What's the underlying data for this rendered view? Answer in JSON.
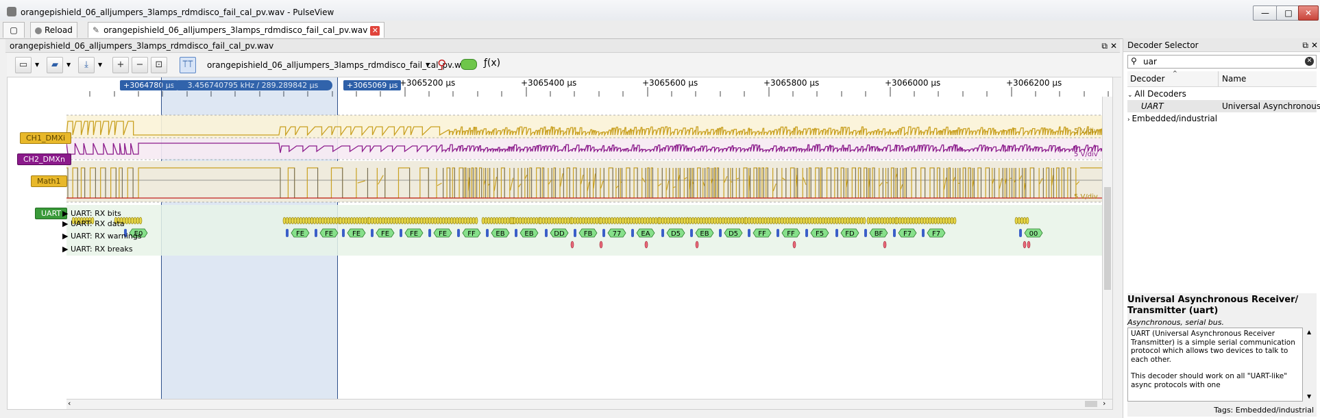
{
  "window": {
    "title": "orangepishield_06_alljumpers_3lamps_rdmdisco_fail_cal_pv.wav - PulseView",
    "min_label": "—",
    "max_label": "□",
    "close_label": "✕"
  },
  "tabs": {
    "reload_label": "Reload",
    "session_tab_label": "orangepishield_06_alljumpers_3lamps_rdmdisco_fail_cal_pv.wav"
  },
  "session_dock": {
    "title": "orangepishield_06_alljumpers_3lamps_rdmdisco_fail_cal_pv.wav"
  },
  "toolbar": {
    "device_label": "orangepishield_06_alljumpers_3lamps_rdmdisco_fail_cal_pv.wav"
  },
  "ruler": {
    "cursor_left": "+3064780 µs",
    "cursor_mid": "3.456740795 kHz / 289.289842 µs",
    "cursor_right": "+3065069 µs",
    "ticks": [
      "+3065200 µs",
      "+3065400 µs",
      "+3065600 µs",
      "+3065800 µs",
      "+3066000 µs",
      "+3066200 µs"
    ]
  },
  "signals": {
    "ch1": {
      "name": "CH1_DMXi",
      "color": "#c9a020",
      "scale": "5 V/div"
    },
    "ch2": {
      "name": "CH2_DMXn",
      "color": "#8b1a8b",
      "scale": "5 V/div"
    },
    "math": {
      "name": "Math1",
      "color": "#c9a020",
      "scale": "5 V/div"
    },
    "uart": {
      "name": "UART",
      "color": "#3a9a3a"
    }
  },
  "decoder_rows": {
    "rx_bits": "UART: RX bits",
    "rx_data": "UART: RX data",
    "rx_warnings": "UART: RX warnings",
    "rx_breaks": "UART: RX breaks"
  },
  "rx_data_values": [
    "E0",
    "FE",
    "FE",
    "FE",
    "FE",
    "FE",
    "FE",
    "FF",
    "EB",
    "EB",
    "DD",
    "FB",
    "77",
    "EA",
    "D5",
    "EB",
    "D5",
    "FF",
    "FF",
    "F5",
    "FD",
    "BF",
    "F7",
    "F7",
    "00"
  ],
  "decoder_selector": {
    "title": "Decoder Selector",
    "search_value": "uar",
    "col_decoder": "Decoder",
    "col_name": "Name",
    "all_decoders": "All Decoders",
    "uart_id": "UART",
    "uart_name": "Universal Asynchronous ...",
    "embedded": "Embedded/industrial",
    "info_title": "Universal Asynchronous Receiver/ Transmitter (uart)",
    "info_subtitle": "Asynchronous, serial bus.",
    "info_desc_1": "UART (Universal Asynchronous Receiver Transmitter) is a simple serial communication protocol which allows two devices to talk to each other.",
    "info_desc_2": "This decoder should work on all \"UART-like\" async protocols with one",
    "tags": "Tags: Embedded/industrial"
  }
}
